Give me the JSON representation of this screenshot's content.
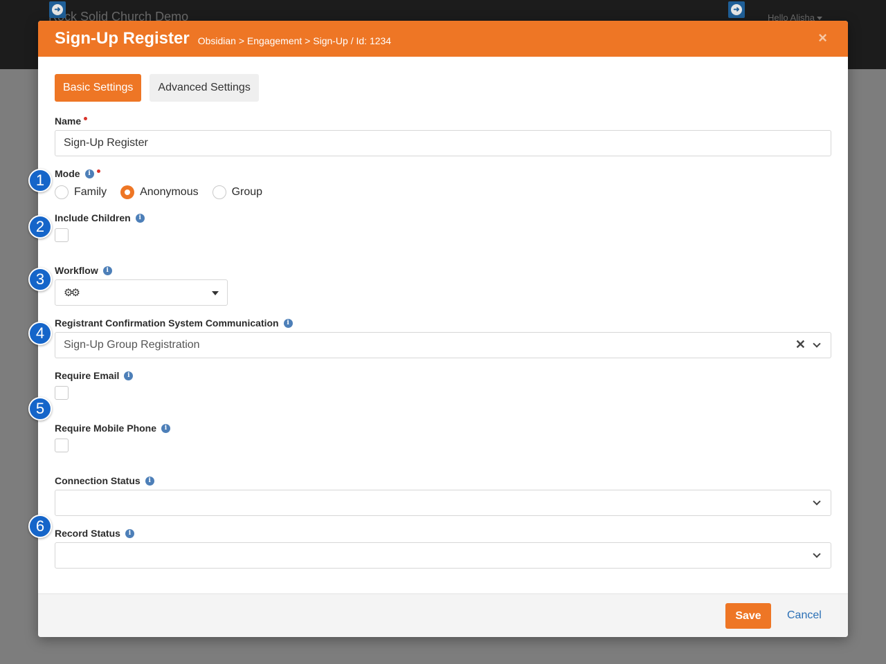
{
  "background": {
    "site_title": "Rock Solid Church Demo",
    "greeting": "Hello Alisha"
  },
  "modal": {
    "title": "Sign-Up Register",
    "breadcrumb": "Obsidian > Engagement > Sign-Up / Id: 1234",
    "close": "×"
  },
  "tabs": [
    {
      "label": "Basic Settings",
      "active": true
    },
    {
      "label": "Advanced Settings",
      "active": false
    }
  ],
  "form": {
    "name": {
      "label": "Name",
      "value": "Sign-Up Register",
      "required": true
    },
    "mode": {
      "label": "Mode",
      "required": true,
      "options": [
        "Family",
        "Anonymous",
        "Group"
      ],
      "selected": "Anonymous"
    },
    "include_children": {
      "label": "Include Children",
      "checked": false
    },
    "workflow": {
      "label": "Workflow",
      "value": ""
    },
    "confirmation_comm": {
      "label": "Registrant Confirmation System Communication",
      "value": "Sign-Up Group Registration"
    },
    "require_email": {
      "label": "Require Email",
      "checked": false
    },
    "require_mobile": {
      "label": "Require Mobile Phone",
      "checked": false
    },
    "connection_status": {
      "label": "Connection Status",
      "value": ""
    },
    "record_status": {
      "label": "Record Status",
      "value": ""
    }
  },
  "footer": {
    "save_label": "Save",
    "cancel_label": "Cancel"
  },
  "callouts": [
    "1",
    "2",
    "3",
    "4",
    "5",
    "6"
  ],
  "colors": {
    "accent": "#ee7625",
    "badge": "#1565c9",
    "info": "#4d7fb8",
    "link": "#2a6fb5"
  }
}
